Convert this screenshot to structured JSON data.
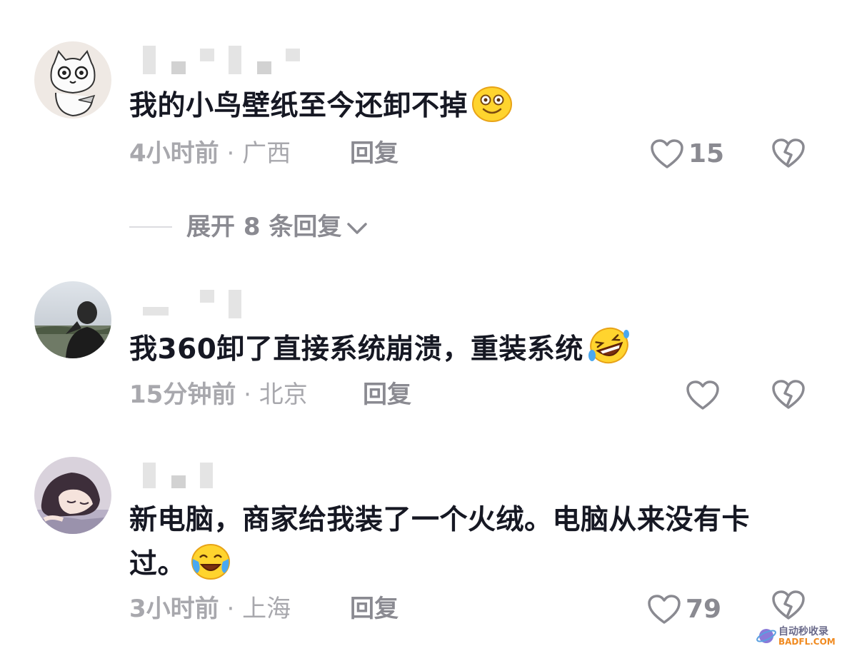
{
  "comments": [
    {
      "text": "我的小鸟壁纸至今还卸不掉",
      "emoji": "grinning-face-emoji",
      "time": "4小时前",
      "location": "广西",
      "reply_label": "回复",
      "likes": "15",
      "avatar": "cartoon-cat-avatar",
      "replies": {
        "label": "展开 8 条回复"
      }
    },
    {
      "text": "我360卸了直接系统崩溃，重装系统",
      "emoji": "rolling-on-floor-laughing-emoji",
      "time": "15分钟前",
      "location": "北京",
      "reply_label": "回复",
      "likes": "",
      "avatar": "photo-person-avatar"
    },
    {
      "text": "新电脑，商家给我装了一个火绒。电脑从来没有卡过。",
      "emoji": "tears-of-joy-emoji",
      "time": "3小时前",
      "location": "上海",
      "reply_label": "回复",
      "likes": "79",
      "avatar": "anime-sleeping-avatar"
    }
  ],
  "meta_separator": "·",
  "icons": {
    "like": "heart-outline-icon",
    "dislike": "broken-heart-icon",
    "expand": "chevron-down-icon"
  },
  "watermark": {
    "line1": "自动秒收录",
    "line2": "BADFL.COM"
  },
  "colors": {
    "primary_text": "#161823",
    "secondary_text": "#a8a8ad",
    "action_text": "#8a8a91"
  }
}
